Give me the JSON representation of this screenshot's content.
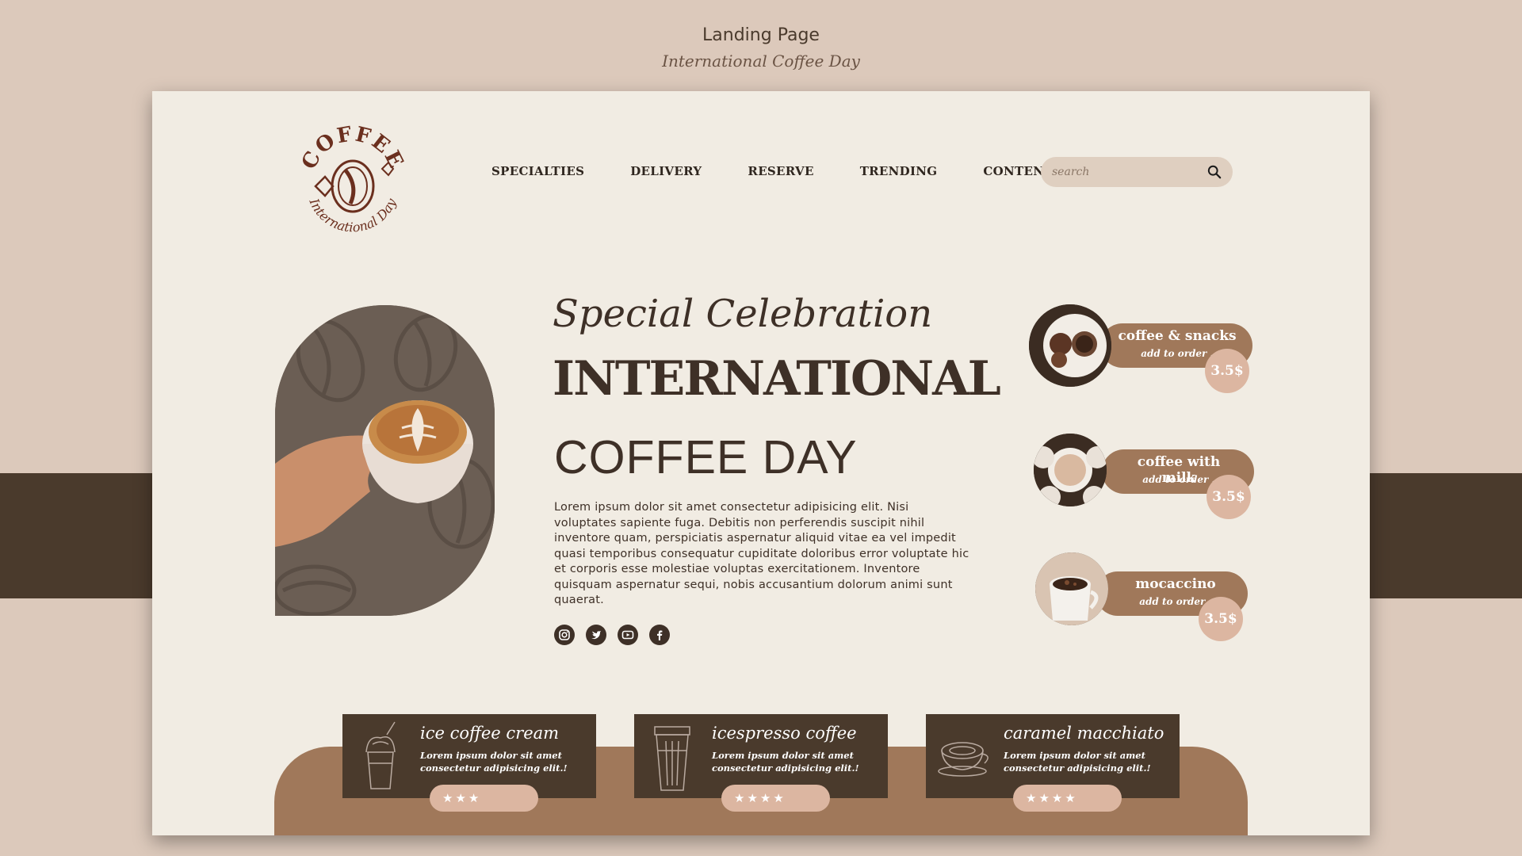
{
  "header": {
    "title": "Landing Page",
    "subtitle": "International Coffee Day"
  },
  "logo": {
    "top_text": "COFFEE",
    "bottom_text": "International Day"
  },
  "nav": {
    "items": [
      "SPECIALTIES",
      "DELIVERY",
      "RESERVE",
      "TRENDING",
      "CONTENT"
    ]
  },
  "search": {
    "placeholder": "search",
    "icon": "search-icon"
  },
  "hero": {
    "script_title": "Special Celebration",
    "title": "INTERNATIONAL",
    "subtitle": "COFFEE DAY",
    "body": "Lorem ipsum dolor sit amet consectetur adipisicing elit. Nisi voluptates sapiente fuga. Debitis non perferendis suscipit nihil inventore quam, perspiciatis aspernatur aliquid vitae ea vel impedit quasi temporibus consequatur cupiditate doloribus error voluptate hic et corporis esse molestiae voluptas exercitationem. Inventore quisquam aspernatur sequi, nobis accusantium dolorum animi sunt quaerat.",
    "social": [
      "instagram-icon",
      "twitter-icon",
      "youtube-icon",
      "facebook-icon"
    ]
  },
  "products": [
    {
      "name": "coffee & snacks",
      "action": "add to order .",
      "price": "3.5$"
    },
    {
      "name": "coffee with milk",
      "action": "add to order .",
      "price": "3.5$"
    },
    {
      "name": "mocaccino",
      "action": "add to order .",
      "price": "3.5$"
    }
  ],
  "cards": [
    {
      "title": "ice  coffee  cream",
      "desc": "Lorem ipsum dolor sit amet consectetur adipisicing elit.!",
      "stars": "★★★"
    },
    {
      "title": "icespresso  coffee",
      "desc": "Lorem ipsum dolor sit amet consectetur adipisicing elit.!",
      "stars": "★★★★"
    },
    {
      "title": "caramel  macchiato",
      "desc": "Lorem ipsum dolor sit amet consectetur adipisicing elit.!",
      "stars": "★★★★"
    }
  ],
  "colors": {
    "background": "#dcc9bb",
    "frame": "#f1ece3",
    "dark_brown": "#4a3a2c",
    "accent": "#a0785a",
    "price_badge": "#dcb6a1"
  }
}
